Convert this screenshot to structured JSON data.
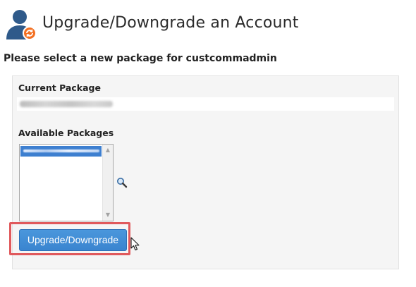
{
  "header": {
    "title": "Upgrade/Downgrade an Account",
    "icon": "user-upgrade-icon"
  },
  "form": {
    "subtitle": "Please select a new package for custcommadmin",
    "current_package": {
      "label": "Current Package",
      "value_redacted": true
    },
    "available_packages": {
      "label": "Available Packages",
      "selected_option_redacted": true,
      "search_icon": "magnifier-icon"
    },
    "submit_button": {
      "label": "Upgrade/Downgrade"
    }
  },
  "colors": {
    "button": "#3d8bd6",
    "highlight": "#e0595c",
    "panel": "#f5f5f5",
    "selection": "#3d7fd0"
  }
}
